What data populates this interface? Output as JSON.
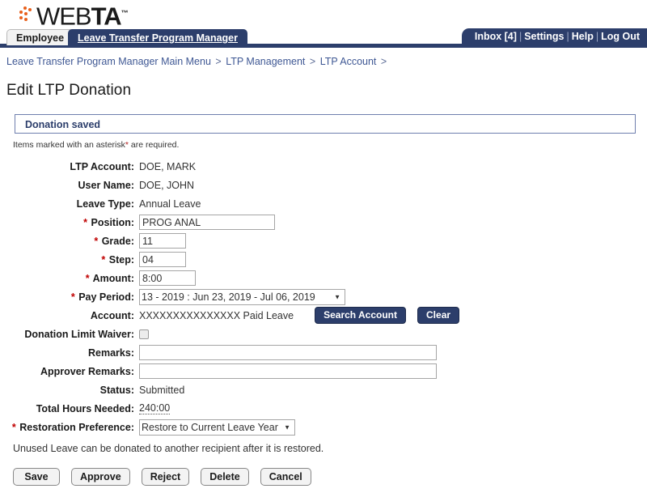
{
  "brand": {
    "name_light": "WEB",
    "name_bold": "TA",
    "trademark": "™"
  },
  "tabs": [
    {
      "label": "Employee",
      "active": false
    },
    {
      "label": "Leave Transfer Program Manager",
      "active": true
    }
  ],
  "topnav": {
    "items": [
      "Inbox [4]",
      "Settings",
      "Help",
      "Log Out"
    ],
    "separator": "|"
  },
  "breadcrumb": {
    "items": [
      "Leave Transfer Program Manager Main Menu",
      "LTP Management",
      "LTP Account"
    ],
    "separator": ">",
    "trailing": ">"
  },
  "page": {
    "title": "Edit LTP Donation",
    "message": "Donation saved",
    "required_note_pre": "Items marked with an asterisk",
    "required_note_ast": "*",
    "required_note_post": " are required."
  },
  "form": {
    "ltp_account": {
      "label": "LTP Account:",
      "value": "DOE, MARK"
    },
    "user_name": {
      "label": "User Name:",
      "value": "DOE, JOHN"
    },
    "leave_type": {
      "label": "Leave Type:",
      "value": "Annual Leave"
    },
    "position": {
      "label": "Position:",
      "value": "PROG ANAL",
      "required": true
    },
    "grade": {
      "label": "Grade:",
      "value": "11",
      "required": true
    },
    "step": {
      "label": "Step:",
      "value": "04",
      "required": true
    },
    "amount": {
      "label": "Amount:",
      "value": "8:00",
      "required": true
    },
    "pay_period": {
      "label": "Pay Period:",
      "value": "13 - 2019 : Jun 23, 2019 - Jul 06, 2019",
      "required": true
    },
    "account": {
      "label": "Account:",
      "value": "XXXXXXXXXXXXXXX Paid Leave",
      "search_button": "Search Account",
      "clear_button": "Clear"
    },
    "donation_limit_waiver": {
      "label": "Donation Limit Waiver:",
      "checked": false
    },
    "remarks": {
      "label": "Remarks:",
      "value": ""
    },
    "approver_remarks": {
      "label": "Approver Remarks:",
      "value": ""
    },
    "status": {
      "label": "Status:",
      "value": "Submitted"
    },
    "total_hours_needed": {
      "label": "Total Hours Needed:",
      "value": "240:00"
    },
    "restoration_preference": {
      "label": "Restoration Preference:",
      "value": "Restore to Current Leave Year",
      "required": true
    },
    "asterisk": "*"
  },
  "footnote": "Unused Leave can be donated to another recipient after it is restored.",
  "actions": [
    {
      "label": "Save"
    },
    {
      "label": "Approve"
    },
    {
      "label": "Reject"
    },
    {
      "label": "Delete"
    },
    {
      "label": "Cancel"
    }
  ],
  "colors": {
    "navy": "#2c3e6b",
    "orange": "#e8601c",
    "required_red": "#c00000",
    "link_blue": "#4a5f93"
  }
}
